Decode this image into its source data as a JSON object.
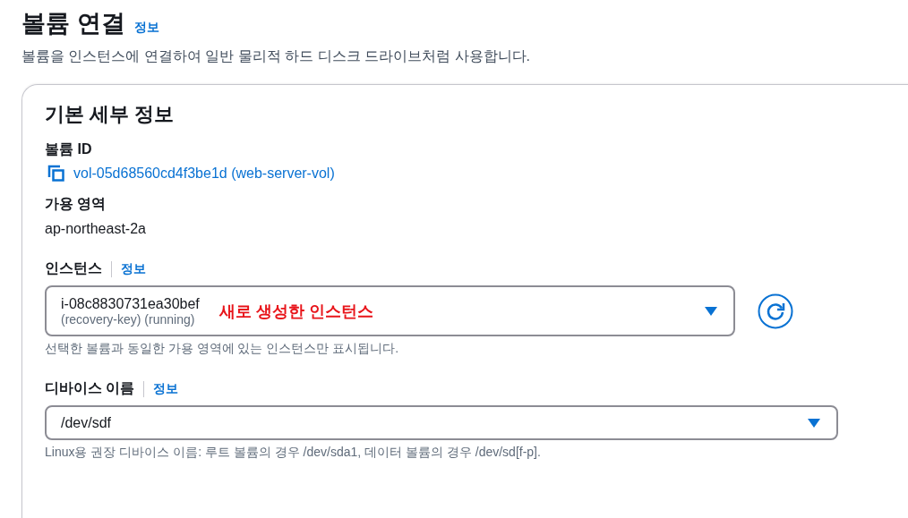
{
  "page": {
    "title": "볼륨 연결",
    "info_link": "정보",
    "description": "볼륨을 인스턴스에 연결하여 일반 물리적 하드 디스크 드라이브처럼 사용합니다."
  },
  "card": {
    "title": "기본 세부 정보",
    "volume_id": {
      "label": "볼륨 ID",
      "value": "vol-05d68560cd4f3be1d (web-server-vol)"
    },
    "availability_zone": {
      "label": "가용 영역",
      "value": "ap-northeast-2a"
    },
    "instance": {
      "label": "인스턴스",
      "info_link": "정보",
      "value": "i-08c8830731ea30bef",
      "secondary": "(recovery-key) (running)",
      "annotation": "새로 생성한 인스턴스",
      "hint": "선택한 볼륨과 동일한 가용 영역에 있는 인스턴스만 표시됩니다."
    },
    "device_name": {
      "label": "디바이스 이름",
      "info_link": "정보",
      "value": "/dev/sdf",
      "hint": "Linux용 권장 디바이스 이름: 루트 볼륨의 경우 /dev/sda1, 데이터 볼륨의 경우 /dev/sd[f-p]."
    }
  }
}
